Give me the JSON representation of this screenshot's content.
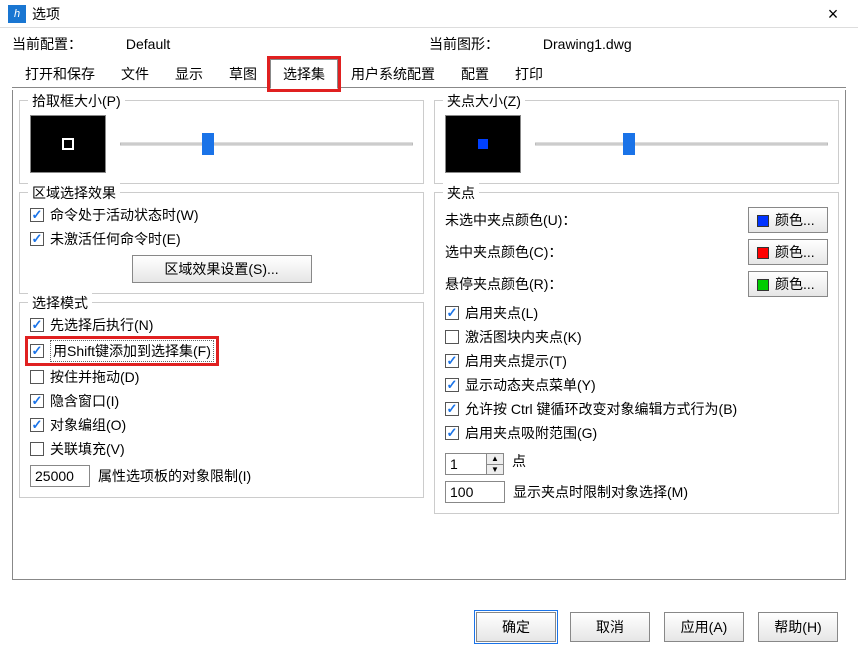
{
  "window": {
    "title": "选项",
    "icon_glyph": "h"
  },
  "header": {
    "current_profile_label": "当前配置：",
    "current_profile_value": "Default",
    "current_drawing_label": "当前图形：",
    "current_drawing_value": "Drawing1.dwg"
  },
  "tabs": [
    "打开和保存",
    "文件",
    "显示",
    "草图",
    "选择集",
    "用户系统配置",
    "配置",
    "打印"
  ],
  "active_tab_index": 4,
  "pickbox": {
    "legend": "拾取框大小(P)",
    "slider_pct": 28
  },
  "gripsize": {
    "legend": "夹点大小(Z)",
    "slider_pct": 30
  },
  "region_effect": {
    "legend": "区域选择效果",
    "chk_active_cmd": "命令处于活动状态时(W)",
    "chk_no_cmd": "未激活任何命令时(E)",
    "settings_btn": "区域效果设置(S)..."
  },
  "select_mode": {
    "legend": "选择模式",
    "items": [
      {
        "key": "noun_verb",
        "label": "先选择后执行(N)",
        "checked": true,
        "hl": false
      },
      {
        "key": "shift_add",
        "label": "用Shift键添加到选择集(F)",
        "checked": true,
        "hl": true,
        "dotted": true
      },
      {
        "key": "press_drag",
        "label": "按住并拖动(D)",
        "checked": false,
        "hl": false
      },
      {
        "key": "implied_win",
        "label": "隐含窗口(I)",
        "checked": true,
        "hl": false
      },
      {
        "key": "obj_group",
        "label": "对象编组(O)",
        "checked": true,
        "hl": false
      },
      {
        "key": "assoc_hatch",
        "label": "关联填充(V)",
        "checked": false,
        "hl": false
      }
    ],
    "limit_value": "25000",
    "limit_label": "属性选项板的对象限制(I)"
  },
  "grips": {
    "legend": "夹点",
    "color_unsel_label": "未选中夹点颜色(U)：",
    "color_unsel": "#0033ff",
    "color_sel_label": "选中夹点颜色(C)：",
    "color_sel": "#ff0000",
    "color_hover_label": "悬停夹点颜色(R)：",
    "color_hover": "#00cc00",
    "color_btn": "颜色...",
    "checks": [
      {
        "label": "启用夹点(L)",
        "checked": true
      },
      {
        "label": "激活图块内夹点(K)",
        "checked": false
      },
      {
        "label": "启用夹点提示(T)",
        "checked": true
      },
      {
        "label": "显示动态夹点菜单(Y)",
        "checked": true
      },
      {
        "label": "允许按 Ctrl 键循环改变对象编辑方式行为(B)",
        "checked": true
      },
      {
        "label": "启用夹点吸附范围(G)",
        "checked": true
      }
    ],
    "spinner_value": "1",
    "spinner_label": "点",
    "limit_value": "100",
    "limit_label": "显示夹点时限制对象选择(M)"
  },
  "buttons": {
    "ok": "确定",
    "cancel": "取消",
    "apply": "应用(A)",
    "help": "帮助(H)"
  }
}
